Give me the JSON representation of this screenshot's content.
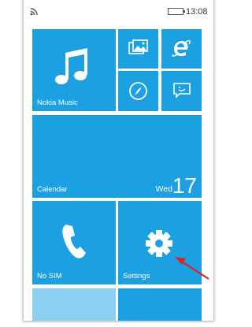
{
  "status_bar": {
    "time": "13:08"
  },
  "tiles": {
    "music": {
      "label": "Nokia Music",
      "icon": "music-note-icon"
    },
    "photos": {
      "icon": "photos-icon"
    },
    "internet_explorer": {
      "icon": "internet-explorer-icon"
    },
    "compass": {
      "icon": "compass-icon"
    },
    "messaging": {
      "icon": "messaging-icon"
    },
    "calendar": {
      "label": "Calendar",
      "day": "Wed",
      "date": "17"
    },
    "phone": {
      "label": "No SIM",
      "icon": "phone-handset-icon"
    },
    "settings": {
      "label": "Settings",
      "icon": "gear-icon"
    }
  },
  "annotation": {
    "icon": "red-arrow-icon",
    "color": "#d9242b"
  },
  "colors": {
    "tile": "#1ba1e2",
    "tile_light": "#8ed0f1"
  }
}
